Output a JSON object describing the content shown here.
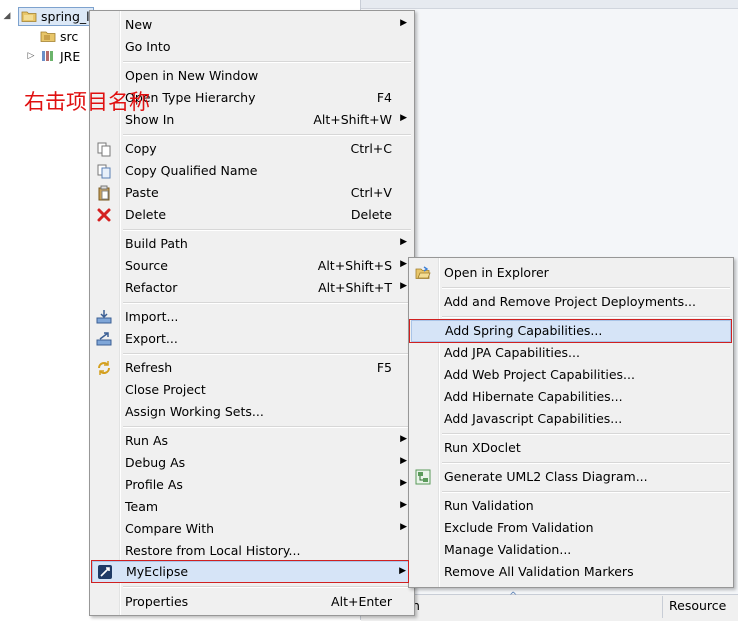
{
  "tree": {
    "project_label": "spring_l",
    "src_label": "src",
    "jre_label": "JRE"
  },
  "annotation": "右击项目名称",
  "context_menu": {
    "new": {
      "label": "New"
    },
    "go_into": {
      "label": "Go Into"
    },
    "open_new_window": {
      "label": "Open in New Window"
    },
    "open_type_hierarchy": {
      "label": "Open Type Hierarchy",
      "shortcut": "F4"
    },
    "show_in": {
      "label": "Show In",
      "shortcut": "Alt+Shift+W"
    },
    "copy": {
      "label": "Copy",
      "shortcut": "Ctrl+C"
    },
    "copy_qualified_name": {
      "label": "Copy Qualified Name"
    },
    "paste": {
      "label": "Paste",
      "shortcut": "Ctrl+V"
    },
    "delete": {
      "label": "Delete",
      "shortcut": "Delete"
    },
    "build_path": {
      "label": "Build Path"
    },
    "source": {
      "label": "Source",
      "shortcut": "Alt+Shift+S"
    },
    "refactor": {
      "label": "Refactor",
      "shortcut": "Alt+Shift+T"
    },
    "import": {
      "label": "Import..."
    },
    "export": {
      "label": "Export..."
    },
    "refresh": {
      "label": "Refresh",
      "shortcut": "F5"
    },
    "close_project": {
      "label": "Close Project"
    },
    "assign_working_sets": {
      "label": "Assign Working Sets..."
    },
    "run_as": {
      "label": "Run As"
    },
    "debug_as": {
      "label": "Debug As"
    },
    "profile_as": {
      "label": "Profile As"
    },
    "team": {
      "label": "Team"
    },
    "compare_with": {
      "label": "Compare With"
    },
    "restore_local_history": {
      "label": "Restore from Local History..."
    },
    "myeclipse": {
      "label": "MyEclipse"
    },
    "properties": {
      "label": "Properties",
      "shortcut": "Alt+Enter"
    }
  },
  "submenu": {
    "open_in_explorer": {
      "label": "Open in Explorer"
    },
    "add_remove_deployments": {
      "label": "Add and Remove Project Deployments..."
    },
    "add_spring": {
      "label": "Add Spring Capabilities..."
    },
    "add_jpa": {
      "label": "Add JPA Capabilities..."
    },
    "add_web_project": {
      "label": "Add Web Project Capabilities..."
    },
    "add_hibernate": {
      "label": "Add Hibernate Capabilities..."
    },
    "add_javascript": {
      "label": "Add Javascript Capabilities..."
    },
    "run_xdoclet": {
      "label": "Run XDoclet"
    },
    "generate_uml2": {
      "label": "Generate UML2 Class Diagram..."
    },
    "run_validation": {
      "label": "Run Validation"
    },
    "exclude_validation": {
      "label": "Exclude From Validation"
    },
    "manage_validation": {
      "label": "Manage Validation..."
    },
    "remove_validation_markers": {
      "label": "Remove All Validation Markers"
    }
  },
  "bottom_panel": {
    "col_description_partial": "tion",
    "col_resource": "Resource"
  },
  "colors": {
    "highlight": "#d6e4f7",
    "annotation_red": "#e01010",
    "red_box": "#d02020"
  }
}
